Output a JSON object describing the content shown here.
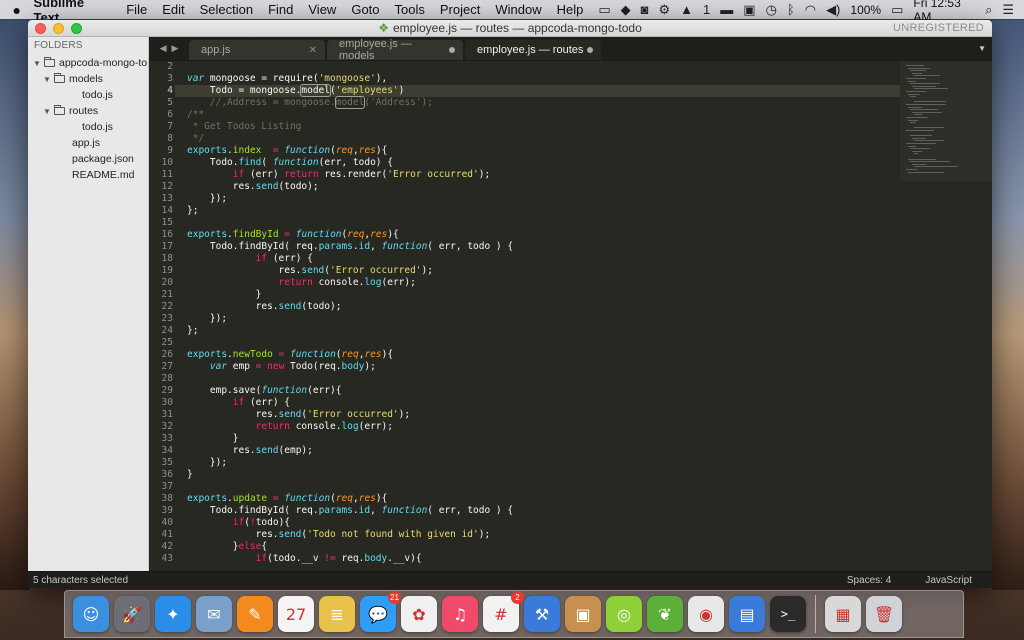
{
  "menubar": {
    "app_name": "Sublime Text",
    "menus": [
      "File",
      "Edit",
      "Selection",
      "Find",
      "View",
      "Goto",
      "Tools",
      "Project",
      "Window",
      "Help"
    ],
    "tray_badge": "1",
    "battery": "100%",
    "clock": "Fri 12:53 AM"
  },
  "window": {
    "title": "employee.js — routes — appcoda-mongo-todo",
    "unregistered": "UNREGISTERED"
  },
  "sidebar": {
    "title": "FOLDERS",
    "items": [
      {
        "label": "appcoda-mongo-to",
        "type": "folder",
        "level": 0,
        "expanded": true
      },
      {
        "label": "models",
        "type": "folder",
        "level": 1,
        "expanded": true
      },
      {
        "label": "todo.js",
        "type": "file",
        "level": 2
      },
      {
        "label": "routes",
        "type": "folder",
        "level": 1,
        "expanded": true
      },
      {
        "label": "todo.js",
        "type": "file",
        "level": 2
      },
      {
        "label": "app.js",
        "type": "file",
        "level": 1
      },
      {
        "label": "package.json",
        "type": "file",
        "level": 1
      },
      {
        "label": "README.md",
        "type": "file",
        "level": 1
      }
    ]
  },
  "tabs": [
    {
      "label": "app.js",
      "active": false,
      "dirty": false
    },
    {
      "label": "employee.js — models",
      "active": false,
      "dirty": true
    },
    {
      "label": "employee.js — routes",
      "active": true,
      "dirty": true
    }
  ],
  "editor": {
    "current_line": 4,
    "lines": [
      {
        "n": 2,
        "html": ""
      },
      {
        "n": 3,
        "html": "<span class=\"kw\">var</span> mongoose = require(<span class=\"st\">'mongoose'</span>),"
      },
      {
        "n": 4,
        "html": "    Todo = mongoose.<span class=\"hl\">model</span>(<span class=\"st\">'employees'</span>)"
      },
      {
        "n": 5,
        "html": "    <span class=\"cm\">//,Address = mongoose.<span class=\"hl\">model</span>('Address');</span>"
      },
      {
        "n": 6,
        "html": "<span class=\"cm\">/**</span>"
      },
      {
        "n": 7,
        "html": "<span class=\"cm\"> * Get Todos Listing</span>"
      },
      {
        "n": 8,
        "html": "<span class=\"cm\"> */</span>"
      },
      {
        "n": 9,
        "html": "<span class=\"vr\">exports</span>.<span class=\"fn\">index</span>  <span class=\"kr\">=</span> <span class=\"kw\">function</span>(<span class=\"pm\">req</span>,<span class=\"pm\">res</span>){"
      },
      {
        "n": 10,
        "html": "    Todo.<span class=\"vr\">find</span>( <span class=\"kw\">function</span>(err, todo) {"
      },
      {
        "n": 11,
        "html": "        <span class=\"kr\">if</span> (err) <span class=\"kr\">return</span> res.render(<span class=\"st\">'Error occurred'</span>);"
      },
      {
        "n": 12,
        "html": "        res.<span class=\"vr\">send</span>(todo);"
      },
      {
        "n": 13,
        "html": "    });"
      },
      {
        "n": 14,
        "html": "};"
      },
      {
        "n": 15,
        "html": ""
      },
      {
        "n": 16,
        "html": "<span class=\"vr\">exports</span>.<span class=\"fn\">findById</span> <span class=\"kr\">=</span> <span class=\"kw\">function</span>(<span class=\"pm\">req</span>,<span class=\"pm\">res</span>){"
      },
      {
        "n": 17,
        "html": "    Todo.findById( req.<span class=\"vr\">params</span>.<span class=\"vr\">id</span>, <span class=\"kw\">function</span>( err, todo ) {"
      },
      {
        "n": 18,
        "html": "            <span class=\"kr\">if</span> (err) {"
      },
      {
        "n": 19,
        "html": "                res.<span class=\"vr\">send</span>(<span class=\"st\">'Error occurred'</span>);"
      },
      {
        "n": 20,
        "html": "                <span class=\"kr\">return</span> console.<span class=\"vr\">log</span>(err);"
      },
      {
        "n": 21,
        "html": "            }"
      },
      {
        "n": 22,
        "html": "            res.<span class=\"vr\">send</span>(todo);"
      },
      {
        "n": 23,
        "html": "    });"
      },
      {
        "n": 24,
        "html": "};"
      },
      {
        "n": 25,
        "html": ""
      },
      {
        "n": 26,
        "html": "<span class=\"vr\">exports</span>.<span class=\"fn\">newTodo</span> <span class=\"kr\">=</span> <span class=\"kw\">function</span>(<span class=\"pm\">req</span>,<span class=\"pm\">res</span>){"
      },
      {
        "n": 27,
        "html": "    <span class=\"kw\">var</span> emp <span class=\"kr\">=</span> <span class=\"kr\">new</span> Todo(req.<span class=\"vr\">body</span>);"
      },
      {
        "n": 28,
        "html": ""
      },
      {
        "n": 29,
        "html": "    emp.save(<span class=\"kw\">function</span>(err){"
      },
      {
        "n": 30,
        "html": "        <span class=\"kr\">if</span> (err) {"
      },
      {
        "n": 31,
        "html": "            res.<span class=\"vr\">send</span>(<span class=\"st\">'Error occurred'</span>);"
      },
      {
        "n": 32,
        "html": "            <span class=\"kr\">return</span> console.<span class=\"vr\">log</span>(err);"
      },
      {
        "n": 33,
        "html": "        }"
      },
      {
        "n": 34,
        "html": "        res.<span class=\"vr\">send</span>(emp);"
      },
      {
        "n": 35,
        "html": "    });"
      },
      {
        "n": 36,
        "html": "}"
      },
      {
        "n": 37,
        "html": ""
      },
      {
        "n": 38,
        "html": "<span class=\"vr\">exports</span>.<span class=\"fn\">update</span> <span class=\"kr\">=</span> <span class=\"kw\">function</span>(<span class=\"pm\">req</span>,<span class=\"pm\">res</span>){"
      },
      {
        "n": 39,
        "html": "    Todo.findById( req.<span class=\"vr\">params</span>.<span class=\"vr\">id</span>, <span class=\"kw\">function</span>( err, todo ) {"
      },
      {
        "n": 40,
        "html": "        <span class=\"kr\">if</span>(<span class=\"kr\">!</span>todo){"
      },
      {
        "n": 41,
        "html": "            res.<span class=\"vr\">send</span>(<span class=\"st\">'Todo not found with given id'</span>);"
      },
      {
        "n": 42,
        "html": "        }<span class=\"kr\">else</span>{"
      },
      {
        "n": 43,
        "html": "            <span class=\"kr\">if</span>(todo.__v <span class=\"kr\">!=</span> req.<span class=\"vr\">body</span>.__v){"
      }
    ]
  },
  "statusbar": {
    "selection": "5 characters selected",
    "indent": "Spaces: 4",
    "syntax": "JavaScript"
  },
  "dock": {
    "apps": [
      {
        "name": "finder",
        "glyph": "☺",
        "color": "#3a8fe0",
        "badge": ""
      },
      {
        "name": "launchpad",
        "glyph": "🚀",
        "color": "#6d6d75",
        "badge": ""
      },
      {
        "name": "safari",
        "glyph": "✦",
        "color": "#2a8ee8",
        "badge": ""
      },
      {
        "name": "mail-bird",
        "glyph": "✉",
        "color": "#7a9fc8",
        "badge": ""
      },
      {
        "name": "pages",
        "glyph": "✎",
        "color": "#f28a1e",
        "badge": ""
      },
      {
        "name": "calendar",
        "glyph": "27",
        "color": "#f4f4f4",
        "badge": ""
      },
      {
        "name": "notes",
        "glyph": "≣",
        "color": "#e8c24a",
        "badge": ""
      },
      {
        "name": "messages",
        "glyph": "💬",
        "color": "#2f9cf5",
        "badge": "21"
      },
      {
        "name": "photos",
        "glyph": "✿",
        "color": "#f0f0f0",
        "badge": ""
      },
      {
        "name": "music",
        "glyph": "♫",
        "color": "#f04a6a",
        "badge": ""
      },
      {
        "name": "slack",
        "glyph": "#",
        "color": "#f2f2f2",
        "badge": "2"
      },
      {
        "name": "xcode",
        "glyph": "⚒",
        "color": "#3a7ad8",
        "badge": ""
      },
      {
        "name": "preview",
        "glyph": "▣",
        "color": "#c89050",
        "badge": ""
      },
      {
        "name": "lime",
        "glyph": "◎",
        "color": "#8ed03a",
        "badge": ""
      },
      {
        "name": "leaf",
        "glyph": "❦",
        "color": "#5cb03a",
        "badge": ""
      },
      {
        "name": "chrome",
        "glyph": "◉",
        "color": "#e8e8e8",
        "badge": ""
      },
      {
        "name": "simulator",
        "glyph": "▤",
        "color": "#3a7ad8",
        "badge": ""
      },
      {
        "name": "terminal",
        "glyph": ">_",
        "color": "#2a2a2a",
        "badge": ""
      }
    ],
    "docs": [
      {
        "name": "documents",
        "glyph": "▦",
        "color": "#d8d8d8"
      },
      {
        "name": "trash",
        "glyph": "🗑",
        "color": "#cfd3d8"
      }
    ]
  }
}
